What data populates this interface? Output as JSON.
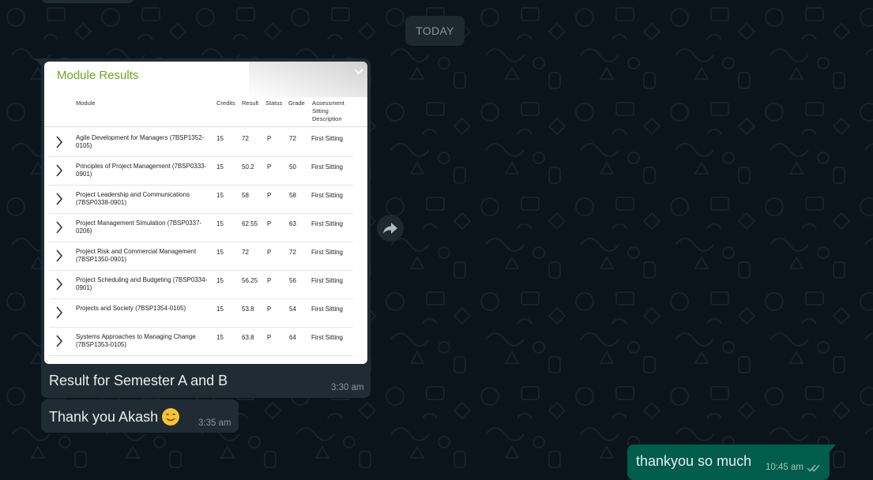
{
  "date_divider": "TODAY",
  "image_message": {
    "title": "Module Results",
    "headers": {
      "module": "Module",
      "credits": "Credits",
      "result": "Result",
      "status": "Status",
      "grade": "Grade",
      "assessment": "Assessment Sitting Description"
    },
    "rows": [
      {
        "module": "Agile Development for Managers (7BSP1352-0105)",
        "credits": "15",
        "result": "72",
        "status": "P",
        "grade": "72",
        "assessment": "First Sitting"
      },
      {
        "module": "Principles of Project Management (7BSP0333-0901)",
        "credits": "15",
        "result": "50.2",
        "status": "P",
        "grade": "50",
        "assessment": "First Sitting"
      },
      {
        "module": "Project Leadership and Communications (7BSP0338-0901)",
        "credits": "15",
        "result": "58",
        "status": "P",
        "grade": "58",
        "assessment": "First Sitting"
      },
      {
        "module": "Project Management Simulation (7BSP0337-0206)",
        "credits": "15",
        "result": "62.55",
        "status": "P",
        "grade": "63",
        "assessment": "First Sitting"
      },
      {
        "module": "Project Risk and Commercial Management (7BSP1350-0901)",
        "credits": "15",
        "result": "72",
        "status": "P",
        "grade": "72",
        "assessment": "First Sitting"
      },
      {
        "module": "Project Scheduling and Budgeting (7BSP0334-0901)",
        "credits": "15",
        "result": "56.25",
        "status": "P",
        "grade": "56",
        "assessment": "First Sitting"
      },
      {
        "module": "Projects and Society (7BSP1354-0105)",
        "credits": "15",
        "result": "53.8",
        "status": "P",
        "grade": "54",
        "assessment": "First Sitting"
      },
      {
        "module": "Systems Approaches to Managing Change (7BSP1353-0105)",
        "credits": "15",
        "result": "63.8",
        "status": "P",
        "grade": "64",
        "assessment": "First Sitting"
      }
    ],
    "caption": "Result for Semester A and B",
    "time": "3:30 am"
  },
  "text_message_in": {
    "text": "Thank you Akash",
    "emoji": "smiling-face-emoji",
    "time": "3:35 am"
  },
  "text_message_out": {
    "text": "thankyou so much",
    "time": "10:45 am",
    "status_icon": "double-check-icon"
  },
  "icons": {
    "forward": "forward-icon",
    "menu_chevron": "chevron-down-icon"
  },
  "colors": {
    "background": "#0b141a",
    "incoming_bubble": "#202c33",
    "outgoing_bubble": "#005c4b",
    "module_title": "#6aa520",
    "read_tick": "#53bdeb"
  }
}
